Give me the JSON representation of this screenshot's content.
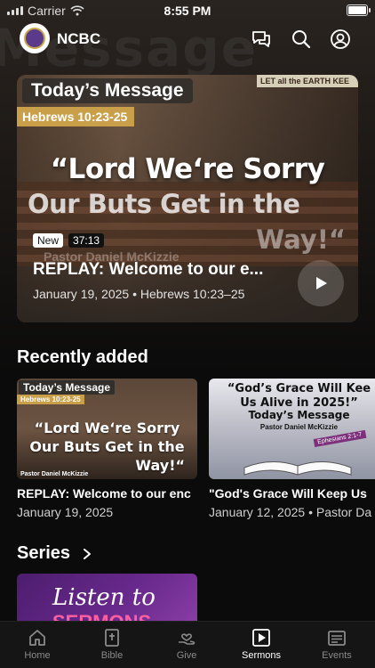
{
  "status_bar": {
    "carrier": "Carrier",
    "time": "8:55 PM"
  },
  "header": {
    "app_name": "NCBC",
    "background_watermark": "Message"
  },
  "hero": {
    "image_label": "Today’s Message",
    "verse_tag": "Hebrews 10:23-25",
    "sign_text": "LET all the EARTH KEE",
    "quote_line1": "“Lord We‘re Sorry",
    "quote_line2": "Our Buts Get in the",
    "quote_line3": "Way!“",
    "pastor_text": "Pastor Daniel McKizzie",
    "badge_new": "New",
    "duration": "37:13",
    "title": "REPLAY: Welcome to our e...",
    "meta": "January 19, 2025 • Hebrews 10:23–25"
  },
  "recently_added": {
    "heading": "Recently added",
    "items": [
      {
        "thumb_label": "Today’s Message",
        "thumb_verse": "Hebrews 10:23-25",
        "thumb_q1": "“Lord We‘re Sorry",
        "thumb_q2": "Our Buts Get in the",
        "thumb_q3": "Way!“",
        "thumb_pastor": "Pastor Daniel McKizzie",
        "title": "REPLAY: Welcome to our enc",
        "meta": "January 19, 2025"
      },
      {
        "thumb_q1": "“God’s Grace Will Kee",
        "thumb_q2": "Us Alive in 2025!”",
        "thumb_q3": "Today’s Message",
        "thumb_pastor": "Pastor Daniel McKizzie",
        "thumb_tag": "Ephesians 2:1-7",
        "title": "\"God's Grace Will Keep Us",
        "meta": "January 12, 2025 • Pastor Da"
      }
    ]
  },
  "series": {
    "heading": "Series",
    "thumb_line1": "Listen to",
    "thumb_line2": "SERMONS"
  },
  "tabs": [
    {
      "label": "Home",
      "icon": "home-icon",
      "active": false
    },
    {
      "label": "Bible",
      "icon": "bible-icon",
      "active": false
    },
    {
      "label": "Give",
      "icon": "give-icon",
      "active": false
    },
    {
      "label": "Sermons",
      "icon": "sermons-icon",
      "active": true
    },
    {
      "label": "Events",
      "icon": "events-icon",
      "active": false
    }
  ]
}
